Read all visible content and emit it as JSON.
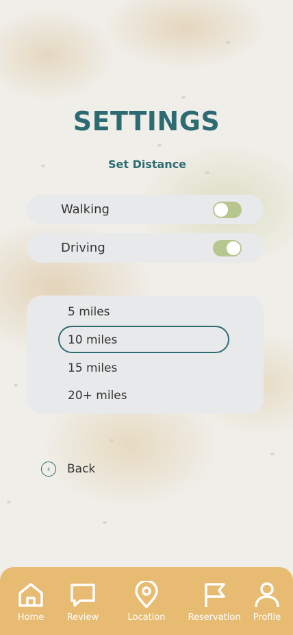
{
  "header": {
    "title": "SETTINGS",
    "subtitle": "Set Distance"
  },
  "mode_toggles": [
    {
      "label": "Walking",
      "enabled": false
    },
    {
      "label": "Driving",
      "enabled": true
    }
  ],
  "distance_options": {
    "items": [
      "5 miles",
      "10 miles",
      "15 miles",
      "20+ miles"
    ],
    "selected": "10 miles"
  },
  "back": {
    "label": "Back",
    "icon": "chevron-left-icon"
  },
  "tabbar": {
    "items": [
      {
        "label": "Home",
        "icon": "home-icon"
      },
      {
        "label": "Review",
        "icon": "speech-bubble-icon"
      },
      {
        "label": "Location",
        "icon": "map-pin-icon"
      },
      {
        "label": "Reservation",
        "icon": "flag-icon"
      },
      {
        "label": "Profile",
        "icon": "user-icon"
      }
    ]
  },
  "colors": {
    "accent": "#2d6b72",
    "toggle_track": "#b7c58f",
    "tabbar": "#e8bb72",
    "card": "#e8e9ea"
  }
}
